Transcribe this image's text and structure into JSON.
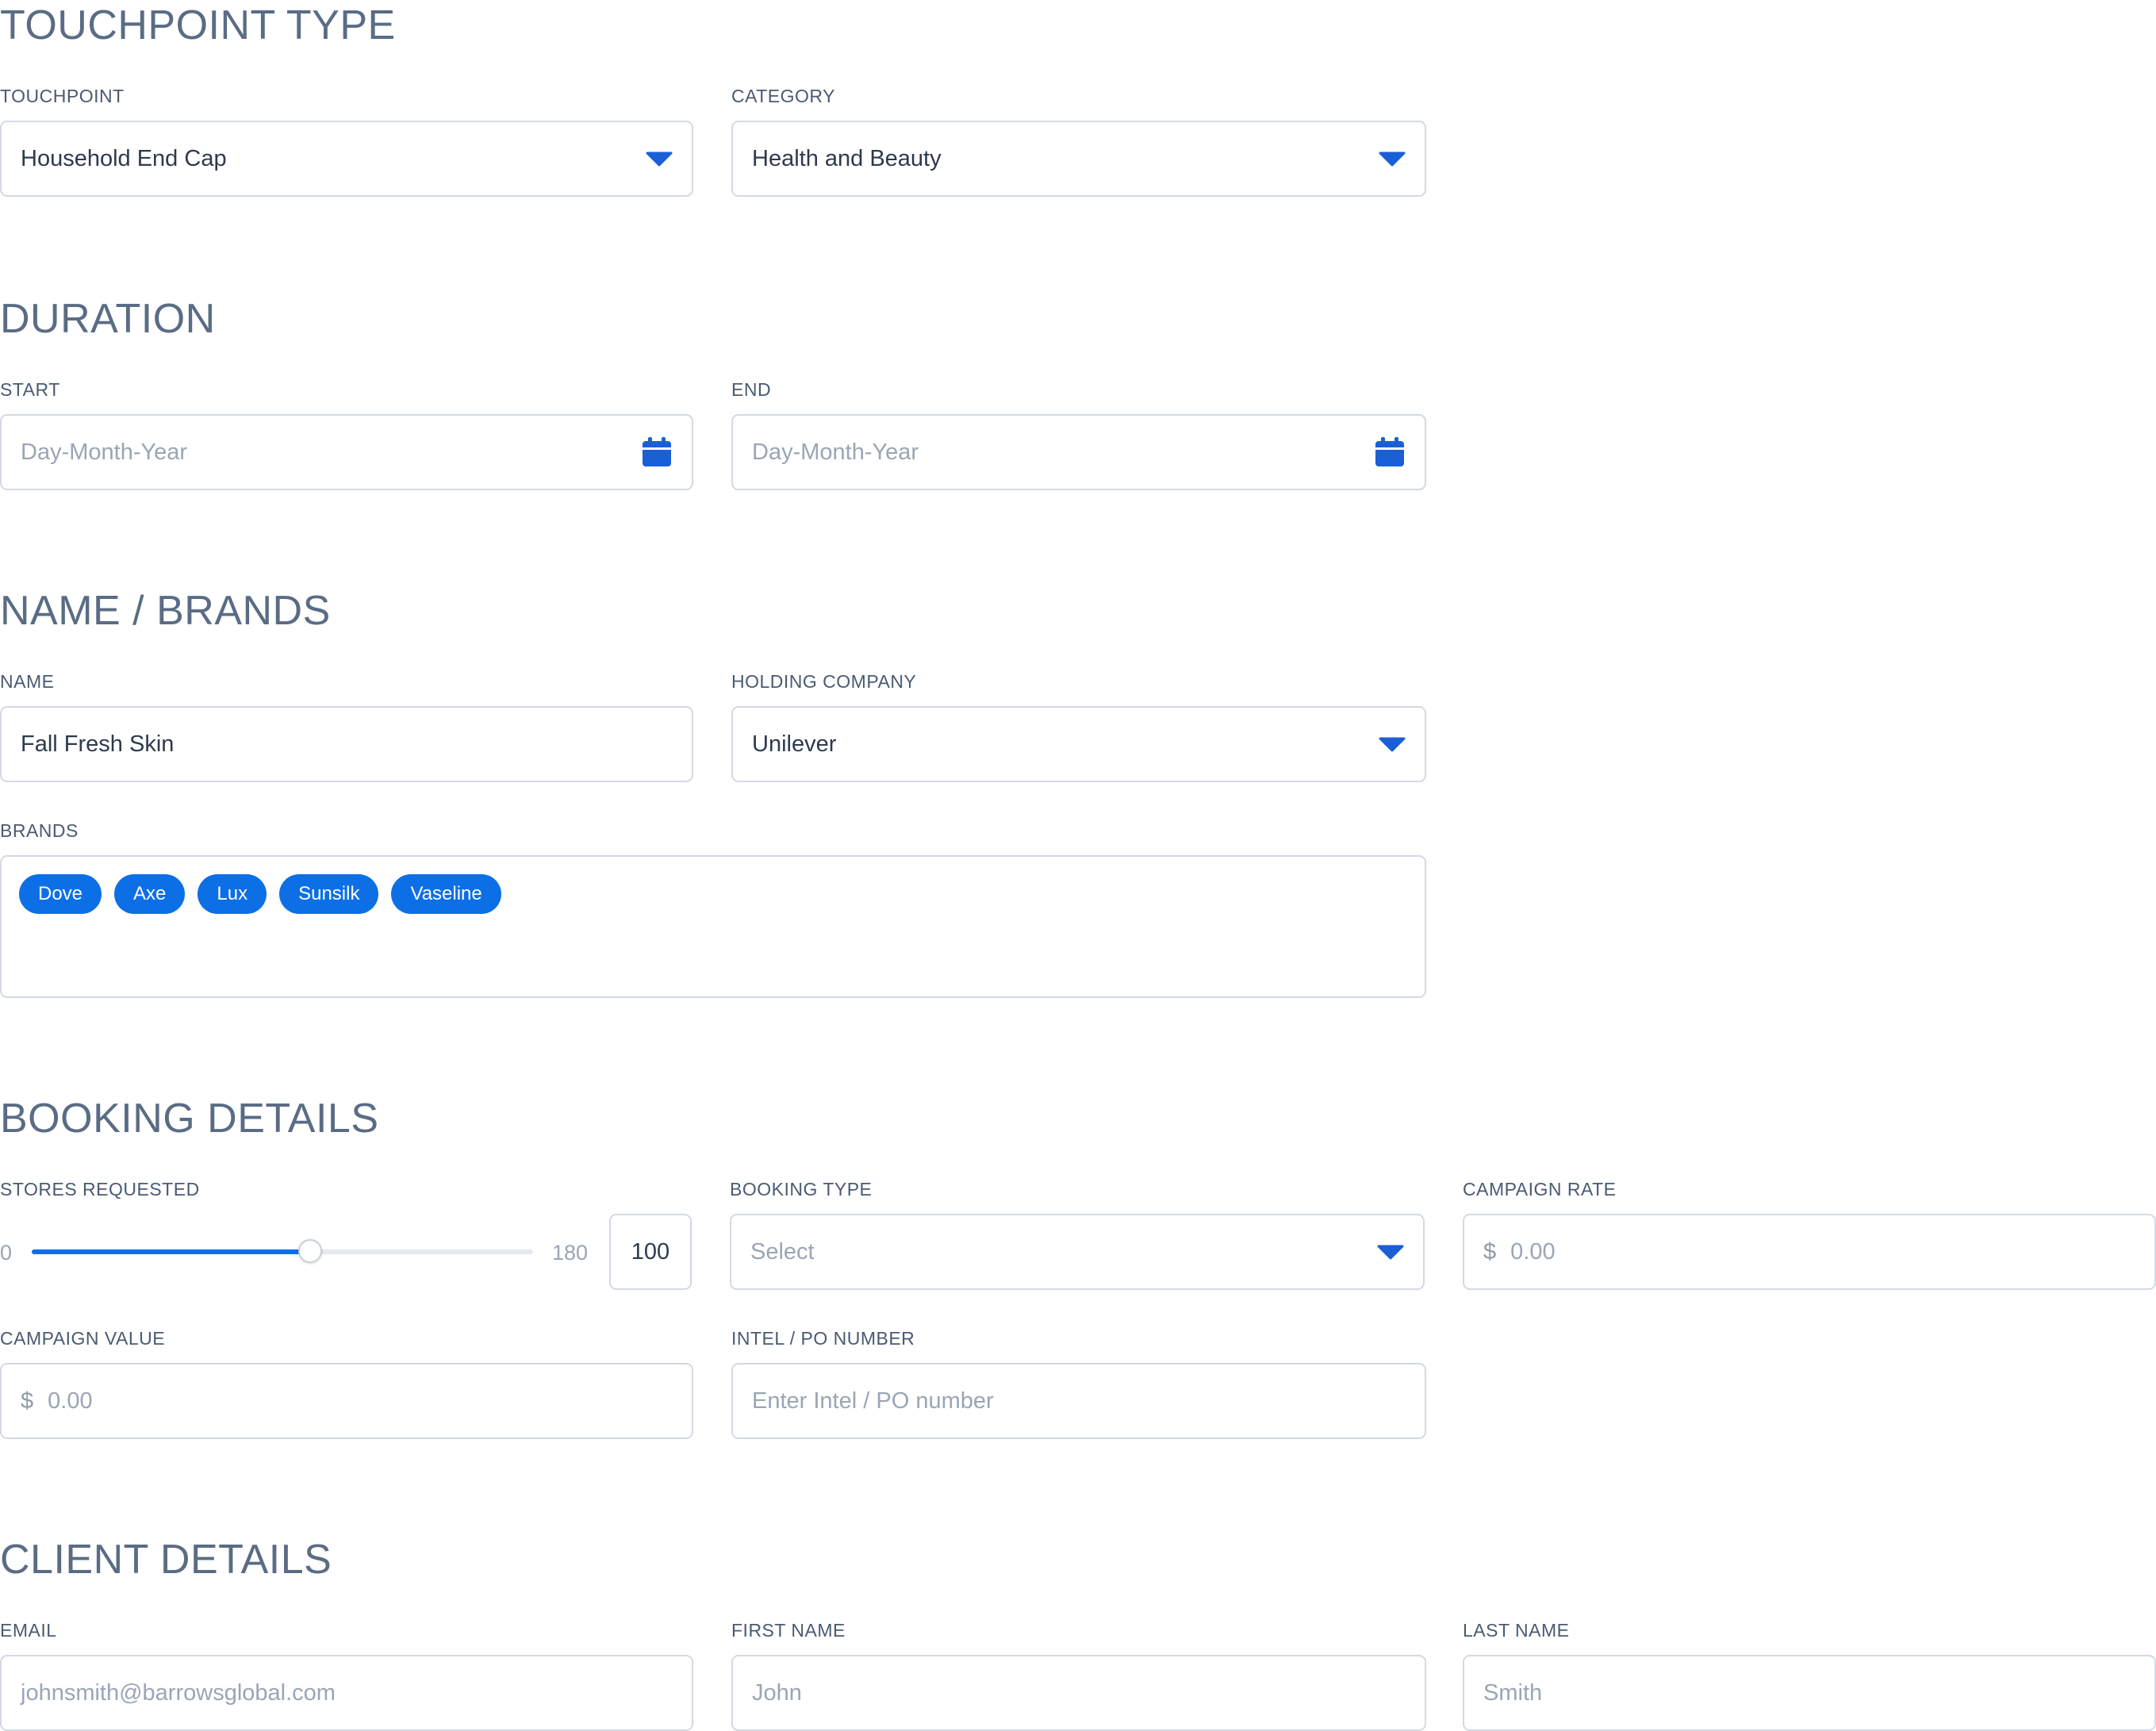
{
  "colors": {
    "accent": "#0d6fe6",
    "title": "#5a6c85",
    "border": "#d3d9e4",
    "placeholder": "#9aa5b6"
  },
  "touchpoint_type": {
    "title": "TOUCHPOINT TYPE",
    "touchpoint": {
      "label": "TOUCHPOINT",
      "value": "Household End Cap",
      "icon": "chevron-down-icon"
    },
    "category": {
      "label": "CATEGORY",
      "value": "Health and Beauty",
      "icon": "chevron-down-icon"
    }
  },
  "duration": {
    "title": "DURATION",
    "start": {
      "label": "START",
      "placeholder": "Day-Month-Year",
      "icon": "calendar-icon"
    },
    "end": {
      "label": "END",
      "placeholder": "Day-Month-Year",
      "icon": "calendar-icon"
    }
  },
  "name_brands": {
    "title": "NAME / BRANDS",
    "name": {
      "label": "NAME",
      "value": "Fall Fresh Skin"
    },
    "holding_company": {
      "label": "HOLDING COMPANY",
      "value": "Unilever",
      "icon": "chevron-down-icon"
    },
    "brands": {
      "label": "BRANDS",
      "tags": [
        "Dove",
        "Axe",
        "Lux",
        "Sunsilk",
        "Vaseline"
      ]
    }
  },
  "booking_details": {
    "title": "BOOKING DETAILS",
    "stores_requested": {
      "label": "STORES REQUESTED",
      "min": "0",
      "max": "180",
      "value": "100",
      "fraction": 0.556
    },
    "booking_type": {
      "label": "BOOKING TYPE",
      "placeholder": "Select",
      "icon": "chevron-down-icon"
    },
    "campaign_rate": {
      "label": "CAMPAIGN RATE",
      "prefix": "$",
      "placeholder": "0.00"
    },
    "campaign_value": {
      "label": "CAMPAIGN VALUE",
      "prefix": "$",
      "placeholder": "0.00"
    },
    "intel_po": {
      "label": "INTEL / PO NUMBER",
      "placeholder": "Enter Intel / PO number"
    }
  },
  "client_details": {
    "title": "CLIENT DETAILS",
    "email": {
      "label": "EMAIL",
      "placeholder": "johnsmith@barrowsglobal.com"
    },
    "first_name": {
      "label": "FIRST NAME",
      "placeholder": "John"
    },
    "last_name": {
      "label": "LAST NAME",
      "placeholder": "Smith"
    }
  }
}
